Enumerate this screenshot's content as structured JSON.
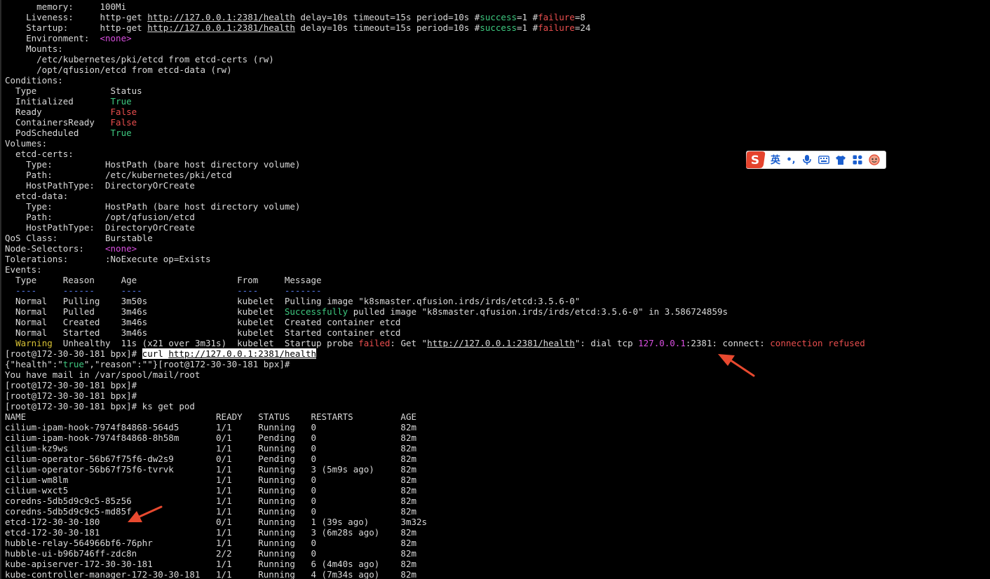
{
  "palette": {
    "background": "#000000",
    "text": "#d9d9d9",
    "green": "#3ec980",
    "red": "#ea4e4e",
    "magenta": "#d94fe0",
    "yellow": "#d8c234",
    "blue": "#5a7ef0",
    "arrow": "#e8492f"
  },
  "ime_toolbar": {
    "logo_letter": "S",
    "lang_label": "英",
    "punct_label": "•,",
    "icons": [
      "microphone-icon",
      "keyboard-icon",
      "shirt-icon",
      "apps-icon",
      "face-icon"
    ]
  },
  "terminal": {
    "lines": [
      [
        {
          "t": "      memory:     100Mi"
        }
      ],
      [
        {
          "t": "    Liveness:     http-get "
        },
        {
          "t": "http://127.0.0.1:2381/health",
          "u": true
        },
        {
          "t": " delay=10s timeout=15s period=10s "
        },
        {
          "t": "#"
        },
        {
          "t": "success",
          "c": "green"
        },
        {
          "t": "=1 #"
        },
        {
          "t": "failure",
          "c": "red"
        },
        {
          "t": "=8"
        }
      ],
      [
        {
          "t": "    Startup:      http-get "
        },
        {
          "t": "http://127.0.0.1:2381/health",
          "u": true
        },
        {
          "t": " delay=10s timeout=15s period=10s "
        },
        {
          "t": "#"
        },
        {
          "t": "success",
          "c": "green"
        },
        {
          "t": "=1 #"
        },
        {
          "t": "failure",
          "c": "red"
        },
        {
          "t": "=24"
        }
      ],
      [
        {
          "t": "    Environment:  "
        },
        {
          "t": "<none>",
          "c": "magenta"
        }
      ],
      [
        {
          "t": "    Mounts:"
        }
      ],
      [
        {
          "t": "      /etc/kubernetes/pki/etcd from etcd-certs (rw)"
        }
      ],
      [
        {
          "t": "      /opt/qfusion/etcd from etcd-data (rw)"
        }
      ],
      [
        {
          "t": "Conditions:"
        }
      ],
      [
        {
          "t": "  Type              Status"
        }
      ],
      [
        {
          "t": "  Initialized       "
        },
        {
          "t": "True",
          "c": "green"
        }
      ],
      [
        {
          "t": "  Ready             "
        },
        {
          "t": "False",
          "c": "red"
        }
      ],
      [
        {
          "t": "  ContainersReady   "
        },
        {
          "t": "False",
          "c": "red"
        }
      ],
      [
        {
          "t": "  PodScheduled      "
        },
        {
          "t": "True",
          "c": "green"
        }
      ],
      [
        {
          "t": "Volumes:"
        }
      ],
      [
        {
          "t": "  etcd-certs:"
        }
      ],
      [
        {
          "t": "    Type:          HostPath (bare host directory volume)"
        }
      ],
      [
        {
          "t": "    Path:          /etc/kubernetes/pki/etcd"
        }
      ],
      [
        {
          "t": "    HostPathType:  DirectoryOrCreate"
        }
      ],
      [
        {
          "t": "  etcd-data:"
        }
      ],
      [
        {
          "t": "    Type:          HostPath (bare host directory volume)"
        }
      ],
      [
        {
          "t": "    Path:          /opt/qfusion/etcd"
        }
      ],
      [
        {
          "t": "    HostPathType:  DirectoryOrCreate"
        }
      ],
      [
        {
          "t": "QoS Class:         Burstable"
        }
      ],
      [
        {
          "t": "Node-Selectors:    "
        },
        {
          "t": "<none>",
          "c": "magenta"
        }
      ],
      [
        {
          "t": "Tolerations:       :NoExecute op=Exists"
        }
      ],
      [
        {
          "t": "Events:"
        }
      ],
      [
        {
          "t": "  Type     Reason     Age                   From     Message"
        }
      ],
      [
        {
          "t": "  ----     ------     ----                  ----     -------",
          "c": "blue"
        }
      ],
      [
        {
          "t": "  Normal   Pulling    3m50s                 kubelet  Pulling image \"k8smaster.qfusion.irds/irds/etcd:3.5.6-0\""
        }
      ],
      [
        {
          "t": "  Normal   Pulled     3m46s                 kubelet  "
        },
        {
          "t": "Successfully",
          "c": "green"
        },
        {
          "t": " pulled image \"k8smaster.qfusion.irds/irds/etcd:3.5.6-0\" in 3.586724859s"
        }
      ],
      [
        {
          "t": "  Normal   Created    3m46s                 kubelet  Created container etcd"
        }
      ],
      [
        {
          "t": "  Normal   Started    3m46s                 kubelet  Started container etcd"
        }
      ],
      [
        {
          "t": "  "
        },
        {
          "t": "Warning",
          "c": "yellow"
        },
        {
          "t": "  Unhealthy  11s (x21 over 3m31s)  kubelet  Startup probe "
        },
        {
          "t": "failed",
          "c": "red"
        },
        {
          "t": ": Get \""
        },
        {
          "t": "http://127.0.0.1:2381/health",
          "u": true
        },
        {
          "t": "\": dial tcp "
        },
        {
          "t": "127.0.0.1",
          "c": "magenta"
        },
        {
          "t": ":2381: connect: "
        },
        {
          "t": "connection refused",
          "c": "red"
        }
      ],
      [
        {
          "t": "[root@172-30-30-181 bpx]# "
        },
        {
          "t": "curl ",
          "hl": true
        },
        {
          "t": "http://127.0.0.1:2381/health",
          "hl": true,
          "u": true
        }
      ],
      [
        {
          "t": "{\"health\":\""
        },
        {
          "t": "true",
          "c": "green"
        },
        {
          "t": "\",\"reason\":\"\"}[root@172-30-30-181 bpx]#"
        }
      ],
      [
        {
          "t": "You have mail in /var/spool/mail/root"
        }
      ],
      [
        {
          "t": "[root@172-30-30-181 bpx]#"
        }
      ],
      [
        {
          "t": "[root@172-30-30-181 bpx]#"
        }
      ],
      [
        {
          "t": "[root@172-30-30-181 bpx]# ks get pod"
        }
      ],
      [
        {
          "t": "NAME                                    READY   STATUS    RESTARTS         AGE"
        }
      ],
      [
        {
          "t": "cilium-ipam-hook-7974f84868-564d5       1/1     Running   0                82m"
        }
      ],
      [
        {
          "t": "cilium-ipam-hook-7974f84868-8h58m       0/1     Pending   0                82m"
        }
      ],
      [
        {
          "t": "cilium-kz9ws                            1/1     Running   0                82m"
        }
      ],
      [
        {
          "t": "cilium-operator-56b67f75f6-dw2s9        0/1     Pending   0                82m"
        }
      ],
      [
        {
          "t": "cilium-operator-56b67f75f6-tvrvk        1/1     Running   3 (5m9s ago)     82m"
        }
      ],
      [
        {
          "t": "cilium-wm8lm                            1/1     Running   0                82m"
        }
      ],
      [
        {
          "t": "cilium-wxct5                            1/1     Running   0                82m"
        }
      ],
      [
        {
          "t": "coredns-5db5d9c9c5-85z56                1/1     Running   0                82m"
        }
      ],
      [
        {
          "t": "coredns-5db5d9c9c5-md85f                1/1     Running   0                82m"
        }
      ],
      [
        {
          "t": "etcd-172-30-30-180                      0/1     Running   1 (39s ago)      3m32s"
        }
      ],
      [
        {
          "t": "etcd-172-30-30-181                      1/1     Running   3 (6m28s ago)    82m"
        }
      ],
      [
        {
          "t": "hubble-relay-564966bf6-76phr            1/1     Running   0                82m"
        }
      ],
      [
        {
          "t": "hubble-ui-b96b746ff-zdc8n               2/2     Running   0                82m"
        }
      ],
      [
        {
          "t": "kube-apiserver-172-30-30-181            1/1     Running   6 (4m40s ago)    82m"
        }
      ],
      [
        {
          "t": "kube-controller-manager-172-30-30-181   1/1     Running   4 (7m34s ago)    82m"
        }
      ]
    ]
  }
}
